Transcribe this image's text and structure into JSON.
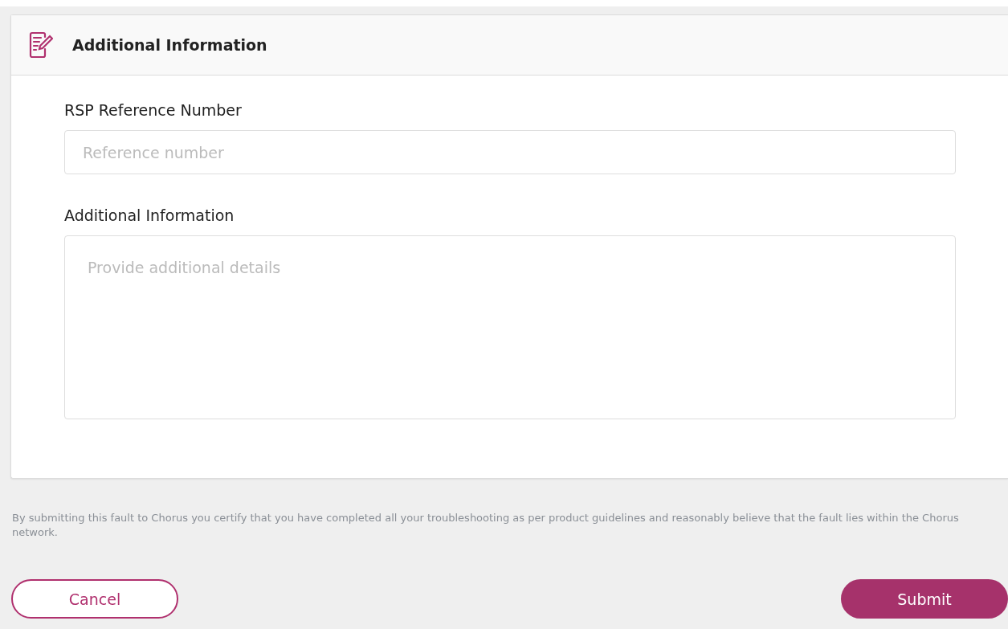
{
  "section": {
    "title": "Additional Information"
  },
  "fields": [
    {
      "kind": "input",
      "label": "RSP Reference Number",
      "placeholder": "Reference number"
    },
    {
      "kind": "textarea",
      "label": "Additional Information",
      "placeholder": "Provide additional details"
    }
  ],
  "disclaimer": "By submitting this fault to Chorus you certify that you have completed all your troubleshooting as per product guidelines and reasonably believe that the fault lies within the Chorus network.",
  "buttons": [
    {
      "kind": "secondary",
      "label": "Cancel"
    },
    {
      "kind": "primary",
      "label": "Submit"
    }
  ]
}
